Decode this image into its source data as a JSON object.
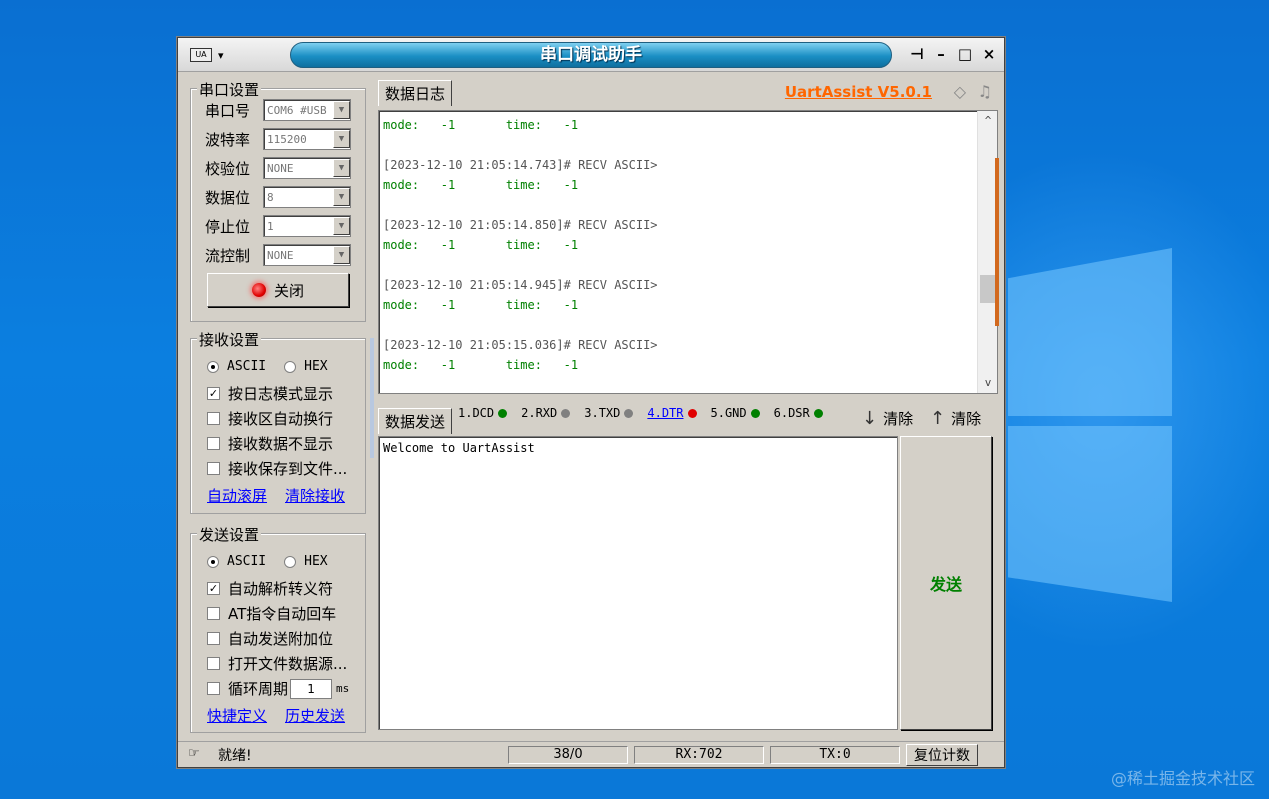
{
  "window": {
    "title": "串口调试助手",
    "menu_logo": "UA",
    "controls": {
      "pin": "⊣",
      "minimize": "–",
      "maximize": "□",
      "close": "×"
    }
  },
  "serial": {
    "title": "串口设置",
    "port_label": "串口号",
    "port_value": "COM6 #USB",
    "baud_label": "波特率",
    "baud_value": "115200",
    "parity_label": "校验位",
    "parity_value": "NONE",
    "data_label": "数据位",
    "data_value": "8",
    "stop_label": "停止位",
    "stop_value": "1",
    "flow_label": "流控制",
    "flow_value": "NONE",
    "close_button": "关闭"
  },
  "receive": {
    "title": "接收设置",
    "ascii": "ASCII",
    "hex": "HEX",
    "opt_log": "按日志模式显示",
    "opt_wrap": "接收区自动换行",
    "opt_hide": "接收数据不显示",
    "opt_save": "接收保存到文件...",
    "link_scroll": "自动滚屏",
    "link_clear": "清除接收"
  },
  "send": {
    "title": "发送设置",
    "ascii": "ASCII",
    "hex": "HEX",
    "opt_escape": "自动解析转义符",
    "opt_at": "AT指令自动回车",
    "opt_append": "自动发送附加位",
    "opt_file": "打开文件数据源...",
    "opt_loop": "循环周期",
    "loop_value": "1",
    "loop_unit": "ms",
    "link_shortcut": "快捷定义",
    "link_history": "历史发送"
  },
  "log": {
    "tab": "数据日志",
    "brand": "UartAssist V5.0.1",
    "lines": [
      {
        "type": "data",
        "text": "mode:   -1       time:   -1"
      },
      {
        "type": "blank",
        "text": ""
      },
      {
        "type": "head",
        "text": "[2023-12-10 21:05:14.743]# RECV ASCII>"
      },
      {
        "type": "data",
        "text": "mode:   -1       time:   -1"
      },
      {
        "type": "blank",
        "text": ""
      },
      {
        "type": "head",
        "text": "[2023-12-10 21:05:14.850]# RECV ASCII>"
      },
      {
        "type": "data",
        "text": "mode:   -1       time:   -1"
      },
      {
        "type": "blank",
        "text": ""
      },
      {
        "type": "head",
        "text": "[2023-12-10 21:05:14.945]# RECV ASCII>"
      },
      {
        "type": "data",
        "text": "mode:   -1       time:   -1"
      },
      {
        "type": "blank",
        "text": ""
      },
      {
        "type": "head",
        "text": "[2023-12-10 21:05:15.036]# RECV ASCII>"
      },
      {
        "type": "data",
        "text": "mode:   -1       time:   -1"
      }
    ]
  },
  "sendpanel": {
    "tab": "数据发送",
    "signals": [
      {
        "label": "1.DCD",
        "color": "#008000"
      },
      {
        "label": "2.RXD",
        "color": "#808080"
      },
      {
        "label": "3.TXD",
        "color": "#808080"
      },
      {
        "label": "4.DTR",
        "color": "#e00000"
      },
      {
        "label": "5.GND",
        "color": "#008000"
      },
      {
        "label": "6.DSR",
        "color": "#008000"
      }
    ],
    "clear1": "清除",
    "clear2": "清除",
    "text": "Welcome to UartAssist",
    "send_button": "发送"
  },
  "status": {
    "ready": "就绪!",
    "count": "38/0",
    "rx": "RX:702",
    "tx": "TX:0",
    "reset": "复位计数"
  },
  "watermark": "@稀土掘金技术社区"
}
